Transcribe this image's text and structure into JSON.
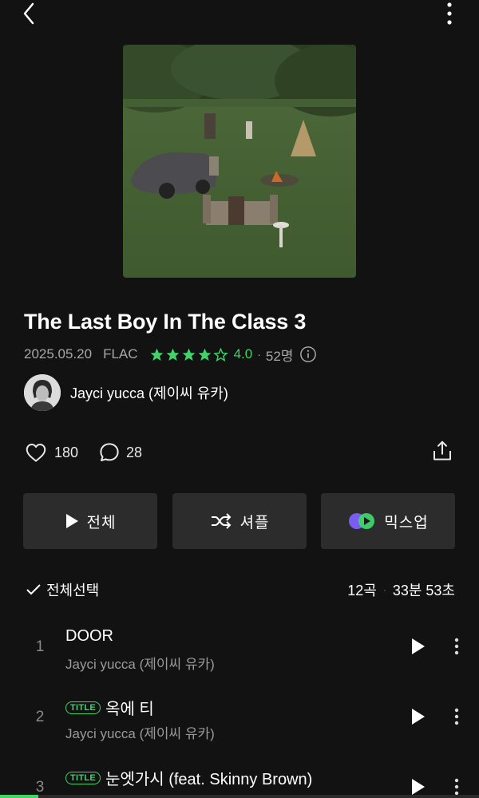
{
  "nav": {
    "back_icon": "chevron-left-icon",
    "more_icon": "vertical-dots-icon"
  },
  "album": {
    "title": "The Last Boy In The Class 3",
    "release_date": "2025.05.20",
    "format": "FLAC",
    "rating": "4.0",
    "rating_value": 4.0,
    "rating_max": 5,
    "rating_count": "52명",
    "artist": "Jayci yucca (제이씨 유카)"
  },
  "social": {
    "likes": "180",
    "comments": "28"
  },
  "actions": {
    "play_all": "전체",
    "shuffle": "셔플",
    "mixup": "믹스업"
  },
  "tracklist": {
    "select_all": "전체선택",
    "count": "12곡",
    "duration": "33분 53초",
    "badge_label": "TITLE",
    "tracks": [
      {
        "num": "1",
        "title": "DOOR",
        "artist": "Jayci yucca (제이씨 유카)",
        "is_title": false
      },
      {
        "num": "2",
        "title": "옥에 티",
        "artist": "Jayci yucca (제이씨 유카)",
        "is_title": true
      },
      {
        "num": "3",
        "title": "눈엣가시 (feat. Skinny Brown)",
        "artist": "",
        "is_title": true
      }
    ]
  },
  "player": {
    "progress": 0.08
  },
  "colors": {
    "accent": "#3fd36a",
    "background": "#121212",
    "button_bg": "#2c2c2c"
  }
}
